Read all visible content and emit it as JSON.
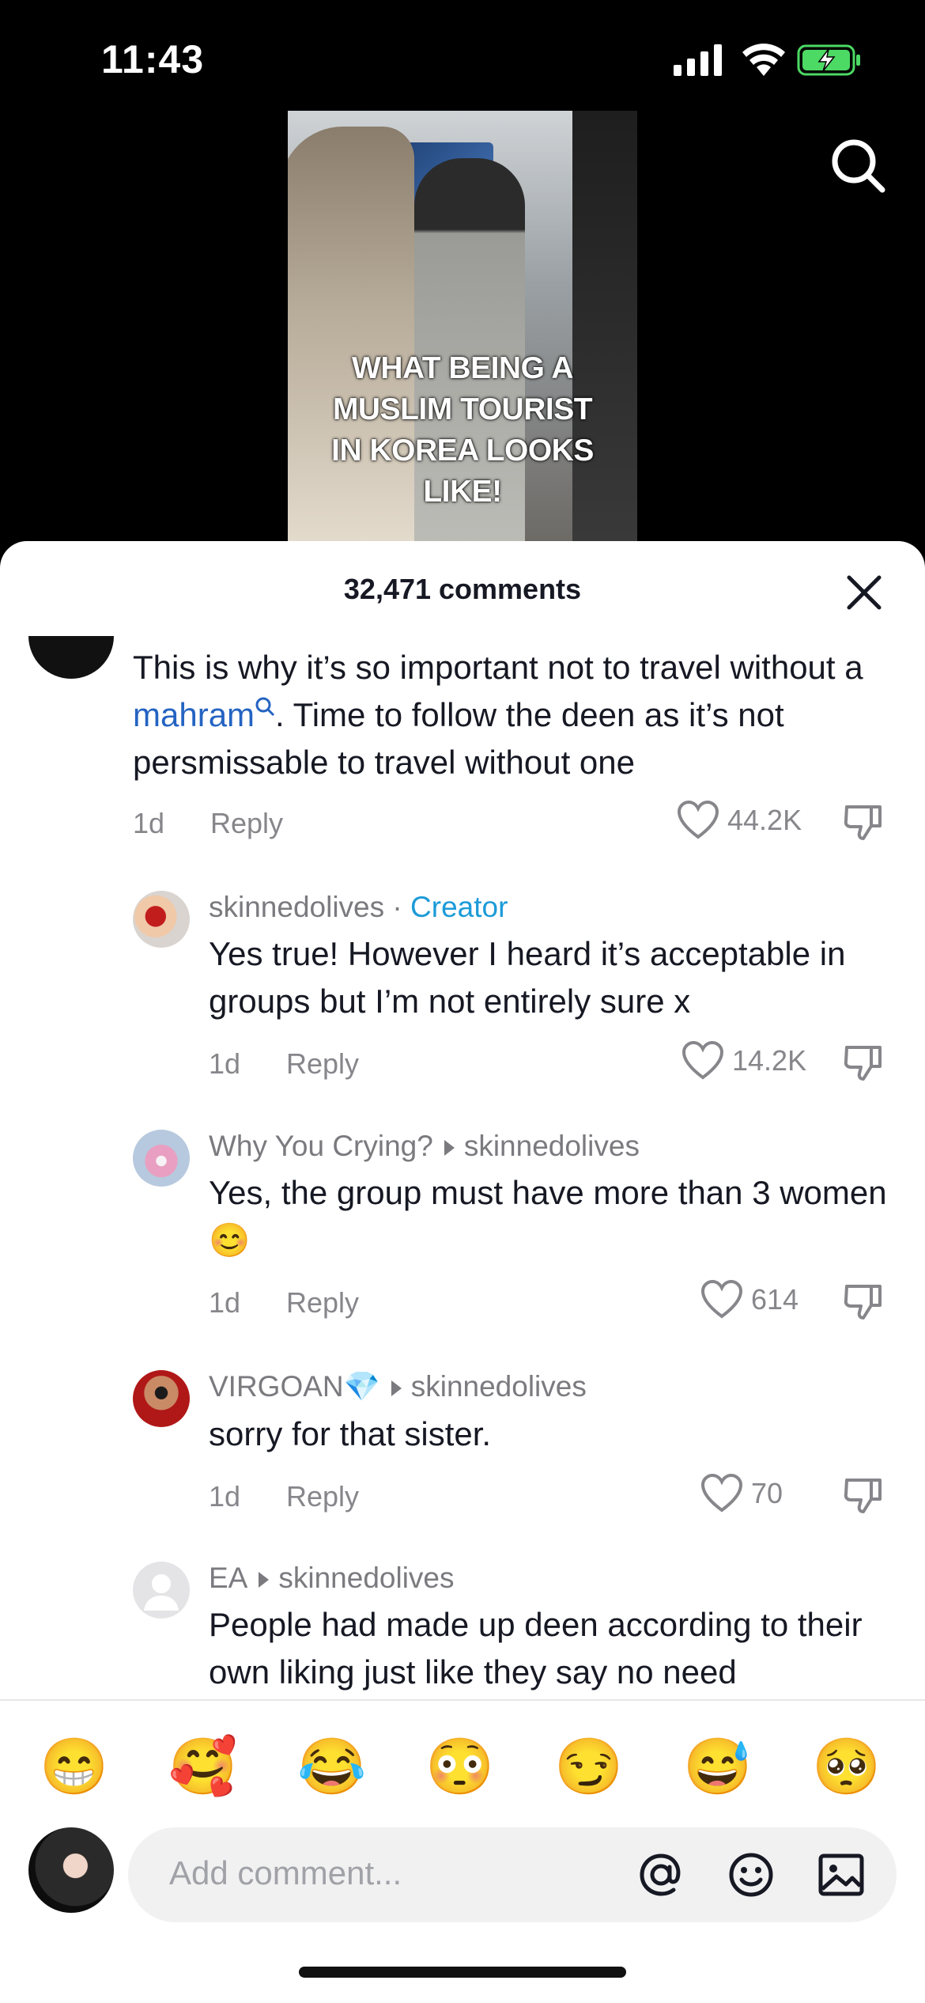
{
  "status_bar": {
    "time": "11:43"
  },
  "video": {
    "caption": [
      "WHAT BEING A",
      "MUSLIM TOURIST",
      "IN KOREA LOOKS",
      "LIKE!"
    ]
  },
  "sheet": {
    "comment_count": "32,471 comments"
  },
  "comments": {
    "top": {
      "text_before": "This is why it’s so important not to travel without a ",
      "link": "mahram",
      "text_after": ". Time to follow the deen as it’s not persmissable to travel without one",
      "time": "1d",
      "reply": "Reply",
      "likes": "44.2K"
    },
    "r1": {
      "name": "skinnedolives",
      "sep": " · ",
      "badge": "Creator",
      "text": "Yes true! However I heard it’s acceptable in groups but I’m not entirely sure x",
      "time": "1d",
      "reply": "Reply",
      "likes": "14.2K"
    },
    "r2": {
      "name": "Why You Crying?",
      "reply_to": "skinnedolives",
      "text": "Yes, the group must have more than 3 women 😊",
      "time": "1d",
      "reply": "Reply",
      "likes": "614"
    },
    "r3": {
      "name": "VIRGOAN💎",
      "reply_to": "skinnedolives",
      "text": "sorry for that sister.",
      "time": "1d",
      "reply": "Reply",
      "likes": "70"
    },
    "r4": {
      "name": "EA",
      "reply_to": "skinnedolives",
      "text": "People had made up deen according to their own liking just like they say no need"
    }
  },
  "emoji_bar": [
    "😁",
    "🥰",
    "😂",
    "😳",
    "😏",
    "😅",
    "🥺"
  ],
  "input": {
    "placeholder": "Add comment..."
  },
  "icons": [
    "search-icon",
    "close-icon",
    "heart-icon",
    "dislike-icon",
    "at-icon",
    "smile-icon",
    "image-icon"
  ]
}
